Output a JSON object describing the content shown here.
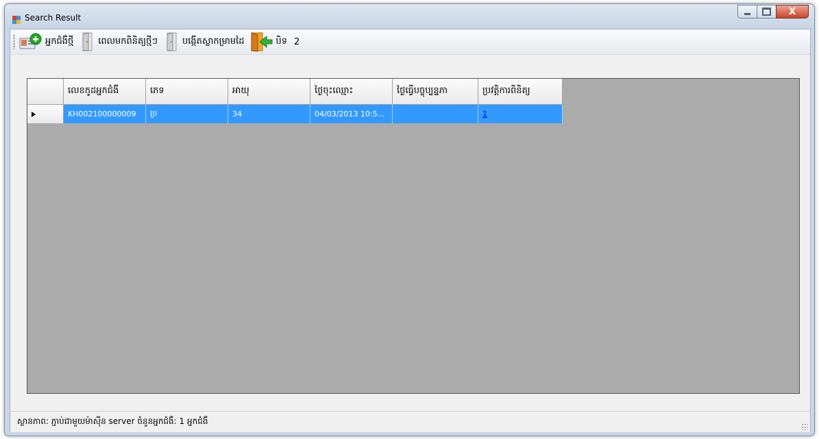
{
  "window": {
    "title": "Search Result",
    "close_symbol": "X"
  },
  "toolbar": {
    "new_patient_label": "អ្នកជំងឺថ្មី",
    "appointment_label": "ពេលមកពិនិត្យថ្មីៗ",
    "prescription_label": "បង្កើតស្លាកម្រាមដៃ",
    "close_label": "បិទ",
    "count_label": "2"
  },
  "grid": {
    "columns": [
      "លេខកូដអ្នកជំងឺ",
      "ភេទ",
      "អាយុ",
      "ថ្ងៃចុះឈ្មោះ",
      "ថ្ងៃធ្វើបច្ចុប្បន្នភា",
      "ប្រវត្តិការពិនិត្យ"
    ],
    "rows": [
      {
        "patient_code": "KH002100000009",
        "gender": "ប្រ",
        "age": "34",
        "registered": "04/03/2013 10:5...",
        "updated": "",
        "history": "1"
      }
    ]
  },
  "status": {
    "text": "ស្ថានភាព: ភ្ជាប់ជាមួយម៉ាស៊ីន server  ចំនួនអ្នកជំងឺ:  1 អ្នកជំងឺ"
  },
  "colors": {
    "selection": "#3399ff",
    "grid_background": "#ababab",
    "link": "#0000ee"
  }
}
